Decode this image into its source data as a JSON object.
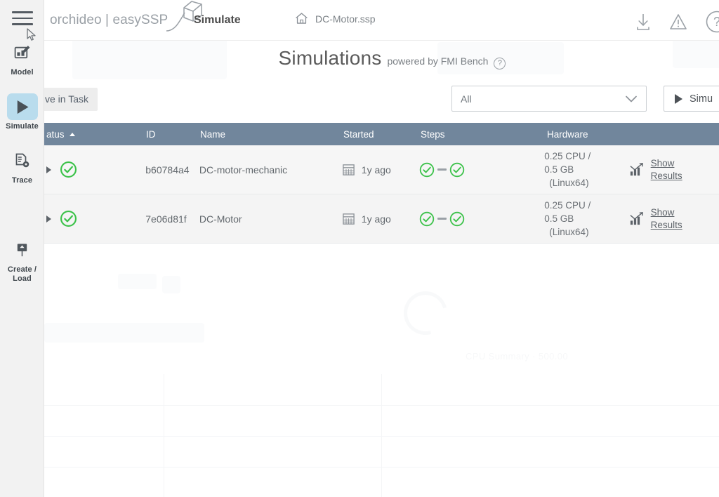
{
  "topbar": {
    "brand": "orchideo | easySSP",
    "brand_cube_icon": "cube-icon",
    "mode": "Simulate",
    "home_icon": "home-icon",
    "file_name": "DC-Motor.ssp",
    "icons": [
      {
        "name": "download-icon",
        "glyph": "download"
      },
      {
        "name": "warning-icon",
        "glyph": "warning"
      },
      {
        "name": "help-icon",
        "glyph": "question"
      }
    ]
  },
  "sidebar": {
    "menu_icon": "hamburger-icon",
    "items": [
      {
        "label": "Model",
        "icon": "model-icon",
        "active": false
      },
      {
        "label": "Simulate",
        "icon": "play-icon",
        "active": true
      },
      {
        "label": "Trace",
        "icon": "trace-icon",
        "active": false
      },
      {
        "label": "Create /\nLoad",
        "icon": "create-load-icon",
        "active": false
      }
    ],
    "item_labels": {
      "model": "Model",
      "simulate": "Simulate",
      "trace": "Trace",
      "create_load_line1": "Create /",
      "create_load_line2": "Load"
    }
  },
  "page": {
    "title": "Simulations",
    "subtitle": "powered by FMI Bench",
    "help_glyph": "?"
  },
  "toolbar": {
    "tab_label": "ve in Task",
    "filter_value": "All",
    "filter_caret_icon": "chevron-down-icon",
    "simulate_button_label": "Simu",
    "simulate_button_icon": "play-icon"
  },
  "table": {
    "columns": [
      {
        "key": "status",
        "label": "atus",
        "sorted": true,
        "sort_dir": "asc"
      },
      {
        "key": "id",
        "label": "ID",
        "sorted": false
      },
      {
        "key": "name",
        "label": "Name",
        "sorted": false
      },
      {
        "key": "started",
        "label": "Started",
        "sorted": false
      },
      {
        "key": "steps",
        "label": "Steps",
        "sorted": false
      },
      {
        "key": "hardware",
        "label": "Hardware",
        "sorted": false
      }
    ],
    "rows": [
      {
        "status_icon": "check-circle-icon",
        "status": "success",
        "id": "b60784a4",
        "name": "DC-motor-mechanic",
        "started_icon": "calendar-icon",
        "started": "1y ago",
        "steps": [
          "success",
          "success"
        ],
        "hardware_cpu": "0.25 CPU /",
        "hardware_mem": "0.5 GB",
        "hardware_os": "(Linux64)",
        "results_icon": "chart-icon",
        "results_label_line1": "Show",
        "results_label_line2": "Results"
      },
      {
        "status_icon": "check-circle-icon",
        "status": "success",
        "id": "7e06d81f",
        "name": "DC-Motor",
        "started_icon": "calendar-icon",
        "started": "1y ago",
        "steps": [
          "success",
          "success"
        ],
        "hardware_cpu": "0.25 CPU /",
        "hardware_mem": "0.5 GB",
        "hardware_os": "(Linux64)",
        "results_icon": "chart-icon",
        "results_label_line1": "Show",
        "results_label_line2": "Results"
      }
    ]
  },
  "colors": {
    "header_bar": "#71869c",
    "success_green": "#3cc24a",
    "sidebar_bg": "#f2f2f2",
    "active_nav": "#b9dced",
    "row_bg": "#f6f6f6",
    "text_muted": "#7c8287"
  }
}
